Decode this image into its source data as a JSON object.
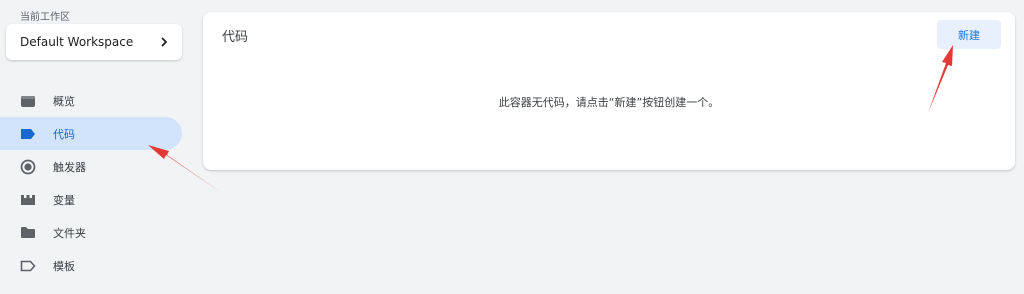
{
  "workspace": {
    "caption": "当前工作区",
    "name": "Default Workspace",
    "chevron_icon": "chevron-right-icon"
  },
  "nav": {
    "items": [
      {
        "label": "概览",
        "icon": "overview-icon"
      },
      {
        "label": "代码",
        "icon": "tag-icon",
        "active": true
      },
      {
        "label": "触发器",
        "icon": "trigger-icon"
      },
      {
        "label": "变量",
        "icon": "variable-icon"
      },
      {
        "label": "文件夹",
        "icon": "folder-icon"
      },
      {
        "label": "模板",
        "icon": "template-icon"
      }
    ]
  },
  "main": {
    "title": "代码",
    "new_button_label": "新建",
    "empty_message": "此容器无代码，请点击“新建”按钮创建一个。"
  },
  "colors": {
    "accent": "#1a73e8",
    "active_nav_bg": "#d2e3fc",
    "annotation_arrow": "#e53935"
  }
}
